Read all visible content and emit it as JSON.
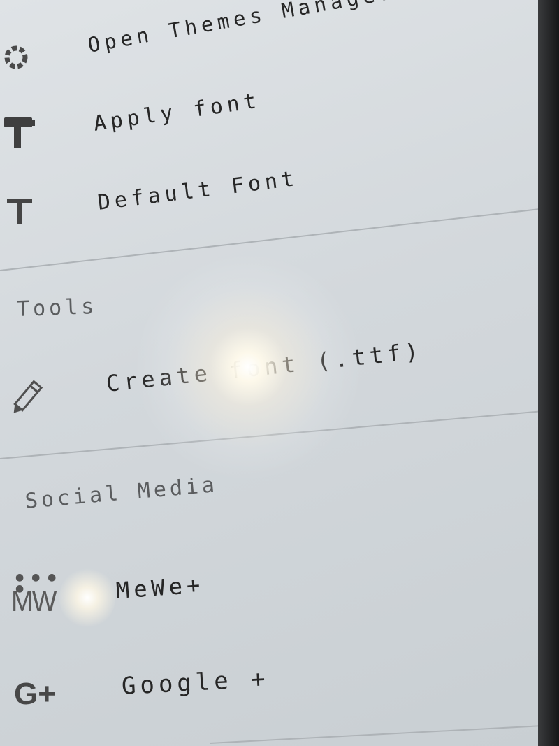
{
  "menu": {
    "theme_items": [
      {
        "label": "Open Themes Manager (Ad)",
        "icon": "themes-manager-icon"
      },
      {
        "label": "Apply font",
        "icon": "paint-roller-icon"
      },
      {
        "label": "Default Font",
        "icon": "text-t-icon"
      }
    ],
    "tools": {
      "header": "Tools",
      "items": [
        {
          "label": "Create font (.ttf)",
          "icon": "pencil-icon"
        }
      ]
    },
    "social_media": {
      "header": "Social Media",
      "items": [
        {
          "label": "MeWe+",
          "icon": "mewe-icon",
          "icon_text": "MW"
        },
        {
          "label": "Google +",
          "icon": "google-plus-icon",
          "icon_text": "G+"
        }
      ]
    }
  },
  "colors": {
    "background": "#d8dcdf",
    "text": "#262626",
    "section_header": "#5a5c5e",
    "divider": "#aeb3b7"
  }
}
